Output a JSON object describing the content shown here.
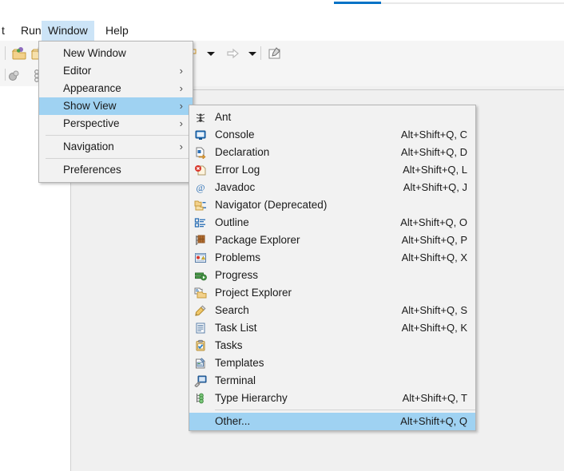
{
  "app": {
    "menubar": [
      {
        "label": "t",
        "name": "menubar-project-truncated",
        "selected": false
      },
      {
        "label": "Run",
        "name": "menubar-run",
        "selected": false
      },
      {
        "label": "Window",
        "name": "menubar-window",
        "selected": true
      },
      {
        "label": "Help",
        "name": "menubar-help",
        "selected": false
      }
    ]
  },
  "colors": {
    "menu_bg": "#f2f2f2",
    "menu_border": "#b4b4b4",
    "highlight": "#9fd2f2",
    "menubar_highlight": "#cce4f7",
    "accent_blue": "#0072c6",
    "toolbar_bg": "#f5f5f5",
    "editor_bg": "#f0f0f0"
  },
  "window_menu": {
    "items": [
      {
        "label": "New Window",
        "submenu": false,
        "selected": false,
        "separator_before": false
      },
      {
        "label": "Editor",
        "submenu": true,
        "selected": false,
        "separator_before": false
      },
      {
        "label": "Appearance",
        "submenu": true,
        "selected": false,
        "separator_before": false
      },
      {
        "label": "Show View",
        "submenu": true,
        "selected": true,
        "separator_before": false
      },
      {
        "label": "Perspective",
        "submenu": true,
        "selected": false,
        "separator_before": false
      },
      {
        "label": "Navigation",
        "submenu": true,
        "selected": false,
        "separator_before": true
      },
      {
        "label": "Preferences",
        "submenu": false,
        "selected": false,
        "separator_before": true
      }
    ],
    "arrow_glyph": "›"
  },
  "show_view_menu": {
    "items": [
      {
        "label": "Ant",
        "accel": "",
        "icon": "ant-icon",
        "selected": false,
        "separator_before": false
      },
      {
        "label": "Console",
        "accel": "Alt+Shift+Q, C",
        "icon": "console-icon",
        "selected": false,
        "separator_before": false
      },
      {
        "label": "Declaration",
        "accel": "Alt+Shift+Q, D",
        "icon": "declaration-icon",
        "selected": false,
        "separator_before": false
      },
      {
        "label": "Error Log",
        "accel": "Alt+Shift+Q, L",
        "icon": "error-log-icon",
        "selected": false,
        "separator_before": false
      },
      {
        "label": "Javadoc",
        "accel": "Alt+Shift+Q, J",
        "icon": "javadoc-icon",
        "selected": false,
        "separator_before": false
      },
      {
        "label": "Navigator (Deprecated)",
        "accel": "",
        "icon": "navigator-icon",
        "selected": false,
        "separator_before": false
      },
      {
        "label": "Outline",
        "accel": "Alt+Shift+Q, O",
        "icon": "outline-icon",
        "selected": false,
        "separator_before": false
      },
      {
        "label": "Package Explorer",
        "accel": "Alt+Shift+Q, P",
        "icon": "package-explorer-icon",
        "selected": false,
        "separator_before": false
      },
      {
        "label": "Problems",
        "accel": "Alt+Shift+Q, X",
        "icon": "problems-icon",
        "selected": false,
        "separator_before": false
      },
      {
        "label": "Progress",
        "accel": "",
        "icon": "progress-icon",
        "selected": false,
        "separator_before": false
      },
      {
        "label": "Project Explorer",
        "accel": "",
        "icon": "project-explorer-icon",
        "selected": false,
        "separator_before": false
      },
      {
        "label": "Search",
        "accel": "Alt+Shift+Q, S",
        "icon": "search-icon",
        "selected": false,
        "separator_before": false
      },
      {
        "label": "Task List",
        "accel": "Alt+Shift+Q, K",
        "icon": "task-list-icon",
        "selected": false,
        "separator_before": false
      },
      {
        "label": "Tasks",
        "accel": "",
        "icon": "tasks-icon",
        "selected": false,
        "separator_before": false
      },
      {
        "label": "Templates",
        "accel": "",
        "icon": "templates-icon",
        "selected": false,
        "separator_before": false
      },
      {
        "label": "Terminal",
        "accel": "",
        "icon": "terminal-icon",
        "selected": false,
        "separator_before": false
      },
      {
        "label": "Type Hierarchy",
        "accel": "Alt+Shift+Q, T",
        "icon": "type-hierarchy-icon",
        "selected": false,
        "separator_before": false
      },
      {
        "label": "Other...",
        "accel": "Alt+Shift+Q, Q",
        "icon": "",
        "selected": true,
        "separator_before": true
      }
    ]
  },
  "toolbar": {
    "icons": [
      {
        "name": "open-type-icon"
      },
      {
        "name": "open-resource-icon"
      },
      {
        "name": "bookmark-icon"
      },
      {
        "name": "dropdown-arrow-icon"
      },
      {
        "name": "forward-arrow-icon"
      },
      {
        "name": "dropdown-arrow-2-icon"
      },
      {
        "name": "new-editor-icon"
      }
    ],
    "row2_icons": [
      {
        "name": "debug-icon"
      },
      {
        "name": "chain-icon"
      },
      {
        "name": "minimize-icon"
      }
    ]
  }
}
